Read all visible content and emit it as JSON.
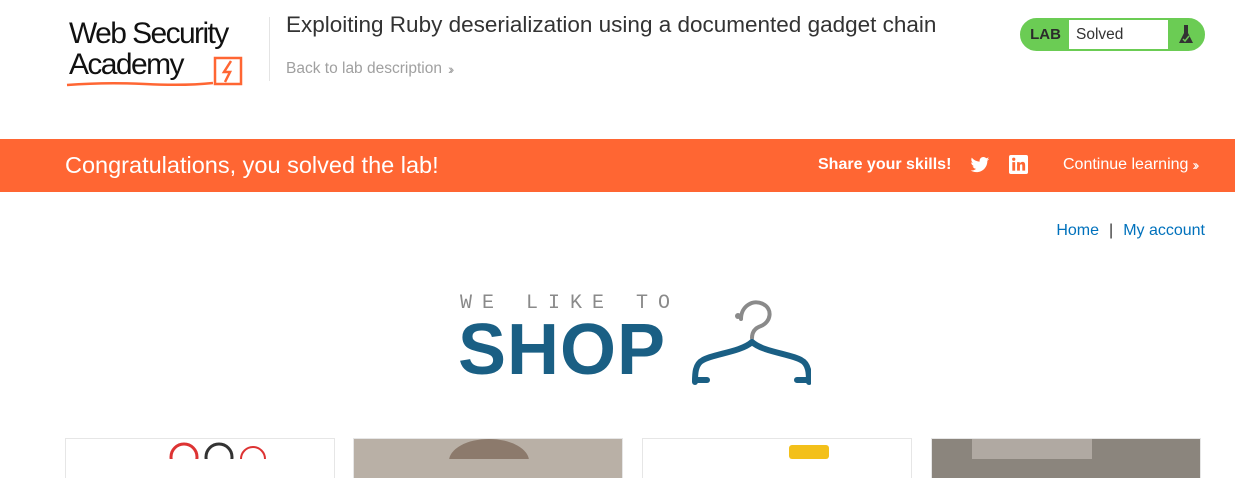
{
  "header": {
    "logo_line1": "Web Security",
    "logo_line2": "Academy",
    "lab_title": "Exploiting Ruby deserialization using a documented gadget chain",
    "back_link": "Back to lab description",
    "status_label": "LAB",
    "status_value": "Solved"
  },
  "banner": {
    "message": "Congratulations, you solved the lab!",
    "share_text": "Share your skills!",
    "continue_link": "Continue learning"
  },
  "nav": {
    "home": "Home",
    "separator": "|",
    "my_account": "My account"
  },
  "shop_logo": {
    "tagline": "WE LIKE TO",
    "name": "SHOP"
  },
  "colors": {
    "accent_orange": "#ff6633",
    "solved_green": "#6bcc54",
    "link_blue": "#0071bc",
    "shop_blue": "#1a5f84"
  },
  "icons": [
    "twitter-icon",
    "linkedin-icon",
    "flask-icon",
    "chevrons-right-icon",
    "hanger-icon"
  ]
}
